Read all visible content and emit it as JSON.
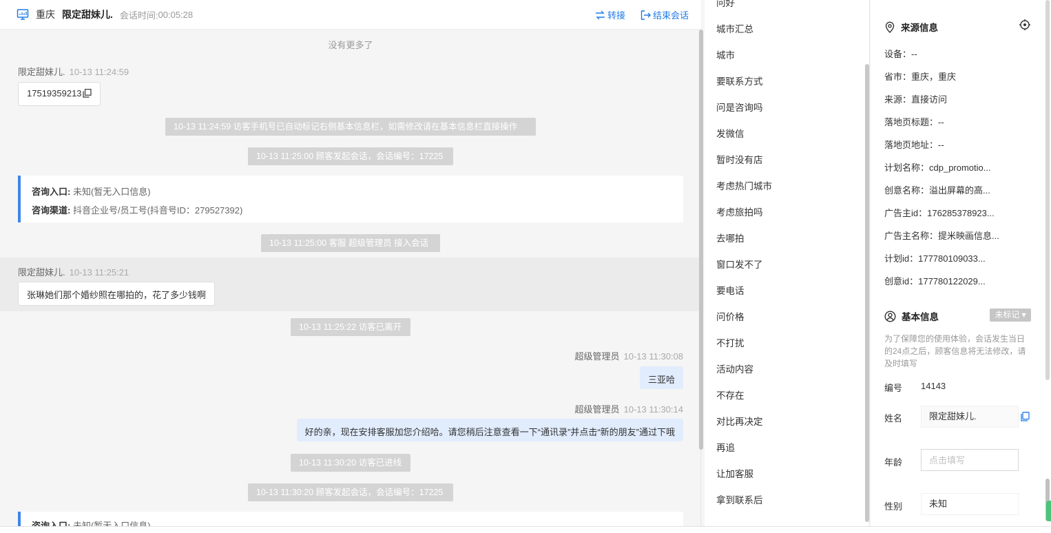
{
  "header": {
    "city": "重庆",
    "visitor_name": "限定甜妹儿.",
    "session_time_label": "会话时间:",
    "session_time": "00:05:28",
    "transfer_label": "转接",
    "end_label": "结束会话"
  },
  "chat": {
    "no_more": "没有更多了",
    "msg1": {
      "sender": "限定甜妹儿.",
      "time": "10-13 11:24:59",
      "text": "17519359213"
    },
    "sys1": "10-13 11:24:59 访客手机号已自动标记右侧基本信息栏，如需修改请在基本信息栏直接操作",
    "sys2": "10-13 11:25:00 顾客发起会话，会话编号：17225",
    "card1": {
      "entry_label": "咨询入口:",
      "entry_value": "未知(暂无入口信息)",
      "channel_label": "咨询渠道:",
      "channel_value": "抖音企业号/员工号(抖音号ID：279527392)"
    },
    "sys3": "10-13 11:25:00 客服 超级管理员 接入会话",
    "msg2": {
      "sender": "限定甜妹儿.",
      "time": "10-13 11:25:21",
      "text": "张琳她们那个婚纱照在哪拍的，花了多少钱啊"
    },
    "sys4": "10-13 11:25:22 访客已离开",
    "msg3": {
      "sender": "超级管理员",
      "time": "10-13 11:30:08",
      "text": "三亚哈"
    },
    "msg4": {
      "sender": "超级管理员",
      "time": "10-13 11:30:14",
      "text": "好的亲，现在安排客服加您介绍哈。请您稍后注意查看一下“通讯录”并点击“新的朋友”通过下哦"
    },
    "sys5": "10-13 11:30:20 访客已进线",
    "sys6": "10-13 11:30:20 顾客发起会话，会话编号：17225",
    "card2": {
      "entry_label": "咨询入口:",
      "entry_value": "未知(暂无入口信息)"
    }
  },
  "quick_replies": [
    "问好",
    "城市汇总",
    "城市",
    "要联系方式",
    "问是咨询吗",
    "发微信",
    "暂时没有店",
    "考虑热门城市",
    "考虑旅拍吗",
    "去哪拍",
    "窗口发不了",
    "要电话",
    "问价格",
    "不打扰",
    "活动内容",
    "不存在",
    "对比再决定",
    "再追",
    "让加客服",
    "拿到联系后"
  ],
  "source_info": {
    "title": "来源信息",
    "rows": [
      "设备：--",
      "省市：重庆，重庆",
      "来源：直接访问",
      "落地页标题：--",
      "落地页地址：--",
      "计划名称：cdp_promotio...",
      "创意名称：溢出屏幕的高...",
      "广告主id：176285378923...",
      "广告主名称：提米映画信息...",
      "计划id：177780109033...",
      "创意id：177780122029..."
    ]
  },
  "basic_info": {
    "title": "基本信息",
    "tag_label": "未标记",
    "note": "为了保障您的使用体验，会话发生当日的24点之后，顾客信息将无法修改，请及时填写",
    "id_label": "编号",
    "id_value": "14143",
    "name_label": "姓名",
    "name_value": "限定甜妹儿.",
    "age_label": "年龄",
    "age_placeholder": "点击填写",
    "gender_label": "性别",
    "gender_value": "未知"
  }
}
